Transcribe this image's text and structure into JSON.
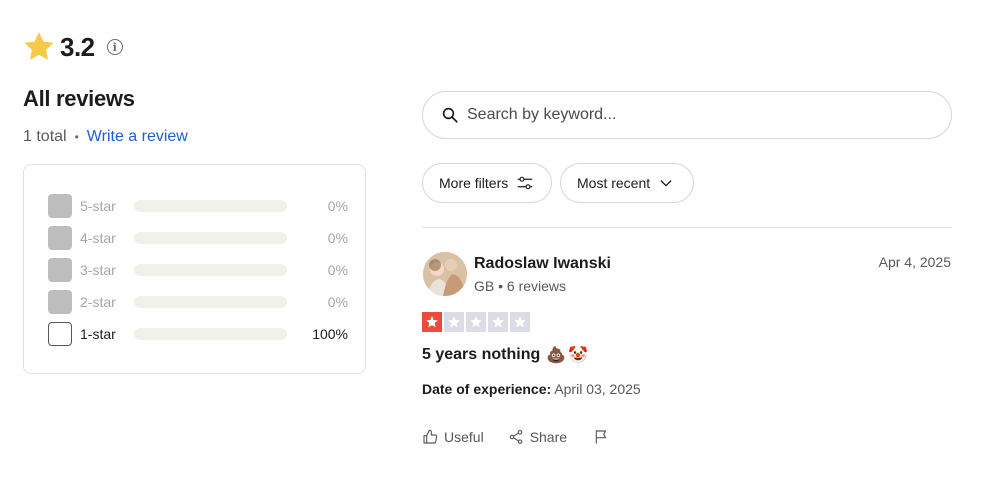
{
  "rating": {
    "value": "3.2",
    "info_icon": "info-icon",
    "star_color": "#f7c948"
  },
  "summary": {
    "heading": "All reviews",
    "total": "1 total",
    "separator": "•",
    "write_link": "Write a review"
  },
  "distribution": [
    {
      "label": "5-star",
      "percent": "0%",
      "fraction": 0,
      "selected": false
    },
    {
      "label": "4-star",
      "percent": "0%",
      "fraction": 0,
      "selected": false
    },
    {
      "label": "3-star",
      "percent": "0%",
      "fraction": 0,
      "selected": false
    },
    {
      "label": "2-star",
      "percent": "0%",
      "fraction": 0,
      "selected": false
    },
    {
      "label": "1-star",
      "percent": "100%",
      "fraction": 1,
      "selected": false
    }
  ],
  "search": {
    "placeholder": "Search by keyword..."
  },
  "filters": {
    "more_filters": "More filters",
    "sort": "Most recent"
  },
  "review": {
    "name": "Radoslaw Iwanski",
    "meta": "GB • 6 reviews",
    "date": "Apr 4, 2025",
    "stars": 1,
    "star_on_color": "#ea4c3a",
    "star_off_color": "#dcdce6",
    "title": "5 years nothing",
    "emoji_1": "💩",
    "emoji_2": "🤡",
    "experience_label": "Date of experience:",
    "experience_date": "April 03, 2025"
  },
  "actions": {
    "useful": "Useful",
    "share": "Share",
    "flag_icon": "flag-icon"
  }
}
